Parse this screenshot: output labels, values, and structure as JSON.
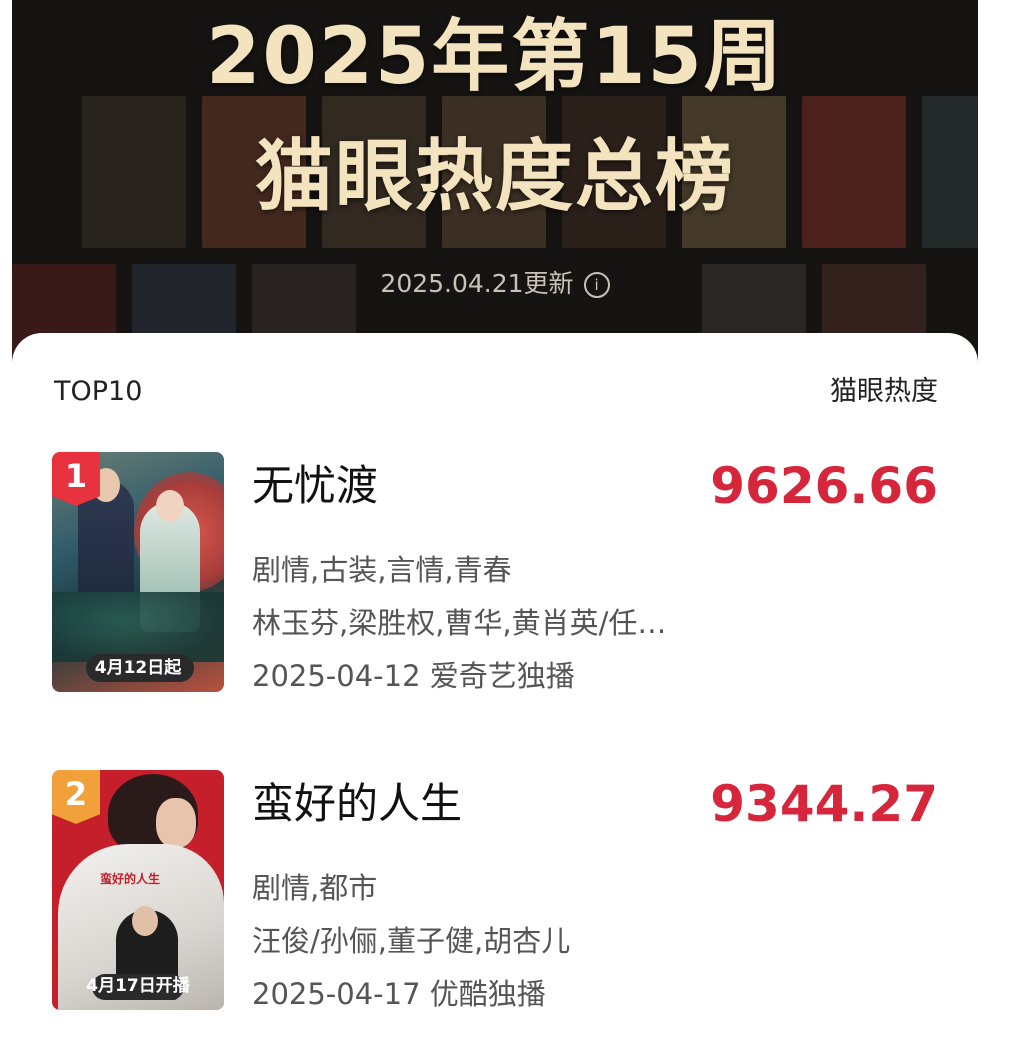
{
  "header": {
    "title_line1": "2025年第15周",
    "title_line2": "猫眼热度总榜",
    "update_text": "2025.04.21更新",
    "info_icon": "i"
  },
  "list": {
    "left_label": "TOP10",
    "right_label": "猫眼热度",
    "items": [
      {
        "rank": "1",
        "title": "无忧渡",
        "score": "9626.66",
        "genres": "剧情,古装,言情,青春",
        "cast": "林玉芬,梁胜权,曹华,黄肖英/任…",
        "release": "2025-04-12 爱奇艺独播",
        "poster_date": "4月12日起",
        "badge_color": "#e8323f"
      },
      {
        "rank": "2",
        "title": "蛮好的人生",
        "score": "9344.27",
        "genres": "剧情,都市",
        "cast": "汪俊/孙俪,董子健,胡杏儿",
        "release": "2025-04-17 优酷独播",
        "poster_date": "4月17日开播",
        "poster_title": "蛮好的人生",
        "badge_color": "#f2a03a"
      }
    ]
  },
  "colors": {
    "score": "#d6263b",
    "header_bg": "#161412",
    "header_text": "#f4e3bf"
  }
}
